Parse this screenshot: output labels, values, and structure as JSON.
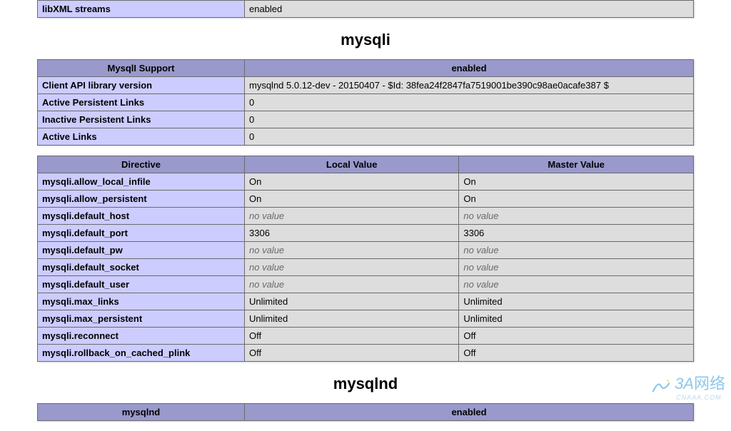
{
  "libxml_row": {
    "key": "libXML streams",
    "value": "enabled"
  },
  "mysqli": {
    "title": "mysqli",
    "support_table": {
      "header_left": "MysqlI Support",
      "header_right": "enabled",
      "rows": [
        {
          "key": "Client API library version",
          "value": "mysqlnd 5.0.12-dev - 20150407 - $Id: 38fea24f2847fa7519001be390c98ae0acafe387 $"
        },
        {
          "key": "Active Persistent Links",
          "value": "0"
        },
        {
          "key": "Inactive Persistent Links",
          "value": "0"
        },
        {
          "key": "Active Links",
          "value": "0"
        }
      ]
    },
    "directives_table": {
      "headers": [
        "Directive",
        "Local Value",
        "Master Value"
      ],
      "rows": [
        {
          "directive": "mysqli.allow_local_infile",
          "local": "On",
          "master": "On"
        },
        {
          "directive": "mysqli.allow_persistent",
          "local": "On",
          "master": "On"
        },
        {
          "directive": "mysqli.default_host",
          "local": "no value",
          "master": "no value",
          "italic": true
        },
        {
          "directive": "mysqli.default_port",
          "local": "3306",
          "master": "3306"
        },
        {
          "directive": "mysqli.default_pw",
          "local": "no value",
          "master": "no value",
          "italic": true
        },
        {
          "directive": "mysqli.default_socket",
          "local": "no value",
          "master": "no value",
          "italic": true
        },
        {
          "directive": "mysqli.default_user",
          "local": "no value",
          "master": "no value",
          "italic": true
        },
        {
          "directive": "mysqli.max_links",
          "local": "Unlimited",
          "master": "Unlimited"
        },
        {
          "directive": "mysqli.max_persistent",
          "local": "Unlimited",
          "master": "Unlimited"
        },
        {
          "directive": "mysqli.reconnect",
          "local": "Off",
          "master": "Off"
        },
        {
          "directive": "mysqli.rollback_on_cached_plink",
          "local": "Off",
          "master": "Off"
        }
      ]
    }
  },
  "mysqlnd": {
    "title": "mysqlnd",
    "header_left": "mysqlnd",
    "header_right": "enabled"
  },
  "watermark": {
    "prefix": "3A",
    "text": "网络",
    "sub": "CNAAA.COM"
  }
}
